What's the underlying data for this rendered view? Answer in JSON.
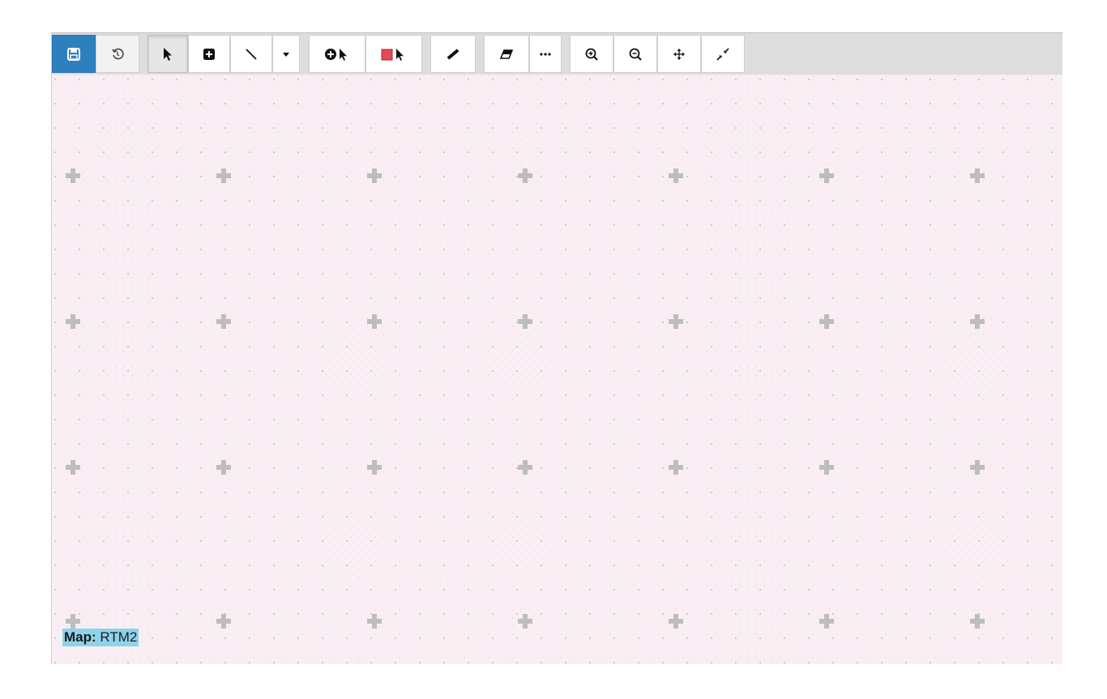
{
  "toolbar": {
    "buttons": [
      {
        "name": "save-button",
        "icon": "save-icon"
      },
      {
        "name": "history-button",
        "icon": "history-icon"
      },
      {
        "name": "select-tool-button",
        "icon": "cursor-arrow-icon"
      },
      {
        "name": "add-node-button",
        "icon": "plus-square-icon"
      },
      {
        "name": "draw-line-button",
        "icon": "line-icon"
      },
      {
        "name": "line-dropdown-button",
        "icon": "caret-down-icon"
      },
      {
        "name": "add-circle-select-button",
        "icon": "circle-cursor-icon"
      },
      {
        "name": "add-rect-select-button",
        "icon": "red-square-cursor-icon"
      },
      {
        "name": "measure-button",
        "icon": "ruler-icon"
      },
      {
        "name": "eraser-button",
        "icon": "eraser-icon"
      },
      {
        "name": "more-options-button",
        "icon": "ellipsis-icon"
      },
      {
        "name": "zoom-in-button",
        "icon": "zoom-in-icon"
      },
      {
        "name": "zoom-out-button",
        "icon": "zoom-out-icon"
      },
      {
        "name": "pan-button",
        "icon": "move-arrows-icon"
      },
      {
        "name": "collapse-button",
        "icon": "compress-icon"
      }
    ],
    "accent_color": "#2e7fbe"
  },
  "canvas": {
    "background_color": "#f9eef3",
    "map_label": {
      "key": "Map:",
      "value": "RTM2"
    },
    "caret_glyph": "ˇ"
  }
}
